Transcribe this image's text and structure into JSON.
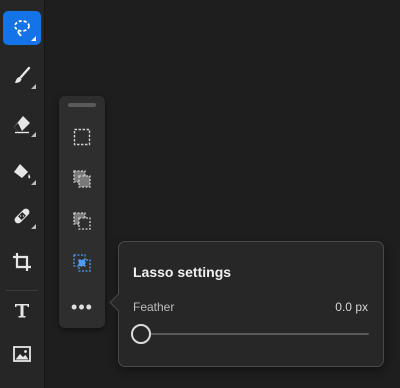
{
  "toolbar": {
    "tools": [
      {
        "name": "lasso-tool",
        "icon": "lasso-icon",
        "active": true
      },
      {
        "name": "brush-tool",
        "icon": "brush-icon"
      },
      {
        "name": "eraser-tool",
        "icon": "eraser-icon"
      },
      {
        "name": "fill-tool",
        "icon": "paint-bucket-icon"
      },
      {
        "name": "healing-tool",
        "icon": "bandage-icon"
      },
      {
        "name": "crop-tool",
        "icon": "crop-icon"
      },
      {
        "name": "text-tool",
        "icon": "text-icon"
      },
      {
        "name": "image-tool",
        "icon": "image-icon"
      }
    ]
  },
  "selection_modes": [
    {
      "name": "new-selection",
      "icon": "new-selection-icon"
    },
    {
      "name": "add-to-selection",
      "icon": "add-selection-icon"
    },
    {
      "name": "subtract-from-selection",
      "icon": "subtract-selection-icon"
    },
    {
      "name": "intersect-selection",
      "icon": "intersect-selection-icon",
      "active": true
    }
  ],
  "more_label": "•••",
  "lasso_settings": {
    "title": "Lasso settings",
    "feather_label": "Feather",
    "feather_value": "0.0 px",
    "feather_slider_fraction": 0.0
  },
  "colors": {
    "accent": "#1473e6",
    "active_mode": "#4b9cf5"
  }
}
